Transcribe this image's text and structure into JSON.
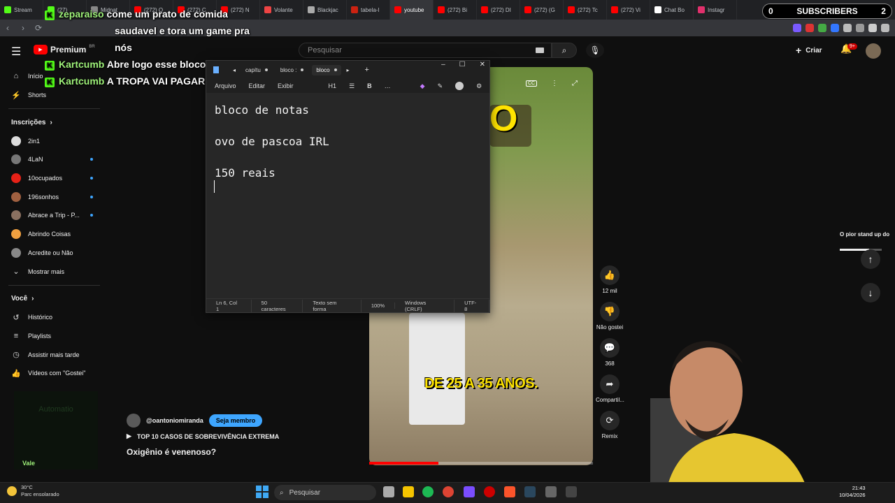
{
  "browser_tabs": [
    {
      "label": "Stream",
      "color": "#53fc18"
    },
    {
      "label": "(27)",
      "color": "#53fc18"
    },
    {
      "label": "Midnat",
      "color": "#888888"
    },
    {
      "label": "(272) O",
      "color": "#ff0000"
    },
    {
      "label": "(272) C",
      "color": "#ff0000"
    },
    {
      "label": "(272) N",
      "color": "#ff0000"
    },
    {
      "label": "Volante",
      "color": "#e44"
    },
    {
      "label": "Blackjac",
      "color": "#aaa"
    },
    {
      "label": "tabela-l",
      "color": "#c21"
    },
    {
      "label": "youtube",
      "color": "#ff0000"
    },
    {
      "label": "(272) Bi",
      "color": "#ff0000"
    },
    {
      "label": "(272) DI",
      "color": "#ff0000"
    },
    {
      "label": "(272) (G",
      "color": "#ff0000"
    },
    {
      "label": "(272) Tc",
      "color": "#ff0000"
    },
    {
      "label": "(272) Vi",
      "color": "#ff0000"
    },
    {
      "label": "Chat Bo",
      "color": "#fff"
    },
    {
      "label": "Instagr",
      "color": "#e1306c"
    }
  ],
  "active_tab_index": 9,
  "youtube": {
    "logo_text": "Premium",
    "logo_region": "BR",
    "search_placeholder": "Pesquisar",
    "create_label": "Criar",
    "notif_badge": "9+"
  },
  "sidebar": {
    "top_items": [
      {
        "label": "Início",
        "icon": "home-icon"
      },
      {
        "label": "Shorts",
        "icon": "shorts-icon"
      }
    ],
    "subs_heading": "Inscrições",
    "channels": [
      {
        "label": "2in1",
        "color": "#ddd",
        "dot": false
      },
      {
        "label": "4LaN",
        "color": "#777",
        "dot": true
      },
      {
        "label": "10ocupados",
        "color": "#e62117",
        "dot": true
      },
      {
        "label": "196sonhos",
        "color": "#a06040",
        "dot": true
      },
      {
        "label": "Abrace a Trip - P...",
        "color": "#8a7060",
        "dot": true
      },
      {
        "label": "Abrindo Coisas",
        "color": "#f0a040",
        "dot": false
      },
      {
        "label": "Acredite ou Não",
        "color": "#888",
        "dot": false
      }
    ],
    "show_more": "Mostrar mais",
    "you_heading": "Você",
    "you_items": [
      {
        "label": "Histórico",
        "icon": "history-icon"
      },
      {
        "label": "Playlists",
        "icon": "playlist-icon"
      },
      {
        "label": "Assistir mais tarde",
        "icon": "clock-icon"
      },
      {
        "label": "Vídeos com \"Gostei\"",
        "icon": "like-icon"
      }
    ]
  },
  "overlay": {
    "subscribers_count_left": "0",
    "subscribers_label": "SUBSCRIBERS",
    "subscribers_count_right": "2",
    "chat": [
      {
        "user": "zeparaiso",
        "text": "come um prato de comida"
      },
      {
        "user": "",
        "text": "saudavel e tora um game pra"
      },
      {
        "user": "",
        "text": "nós"
      },
      {
        "user": "Kartcumb",
        "text": "Abre logo esse bloco"
      },
      {
        "user": "Kartcumb",
        "text": "A TROPA VAI PAGAR"
      }
    ],
    "automatio_label": "Automatio",
    "vale_label": "Vale"
  },
  "notepad": {
    "tabs": [
      "capítu",
      "bloco :",
      "bloco"
    ],
    "menu": [
      "Arquivo",
      "Editar",
      "Exibir"
    ],
    "heading_label": "H1",
    "text": "bloco de notas\n\novo de pascoa IRL\n\n150 reais\n",
    "status": [
      "Ln 6, Col 1",
      "50 caracteres",
      "Texto sem forma",
      "100%",
      "Windows (CRLF)",
      "UTF-8"
    ]
  },
  "video": {
    "caption": "DE 25 A 35 ANOS.",
    "progress": 0.31,
    "actions": [
      {
        "icon": "thumbs-up-icon",
        "label": "12 mil",
        "glyph": "👍"
      },
      {
        "icon": "thumbs-down-icon",
        "label": "Não gostei",
        "glyph": "👎"
      },
      {
        "icon": "comment-icon",
        "label": "368",
        "glyph": "💬"
      },
      {
        "icon": "share-icon",
        "label": "Compartil...",
        "glyph": "➦"
      },
      {
        "icon": "remix-icon",
        "label": "Remix",
        "glyph": "⟳"
      }
    ],
    "channel": "@oantoniomiranda",
    "member_button": "Seja membro",
    "playlist": "TOP 10 CASOS DE SOBREVIVÊNCIA EXTREMA",
    "title": "Oxigênio é venenoso?"
  },
  "right_panel": {
    "mini_title": "O pior stand up do"
  },
  "taskbar": {
    "temp": "30°C",
    "weather": "Parc ensolarado",
    "search": "Pesquisar",
    "time": "21:43",
    "date": "10/04/2026"
  }
}
